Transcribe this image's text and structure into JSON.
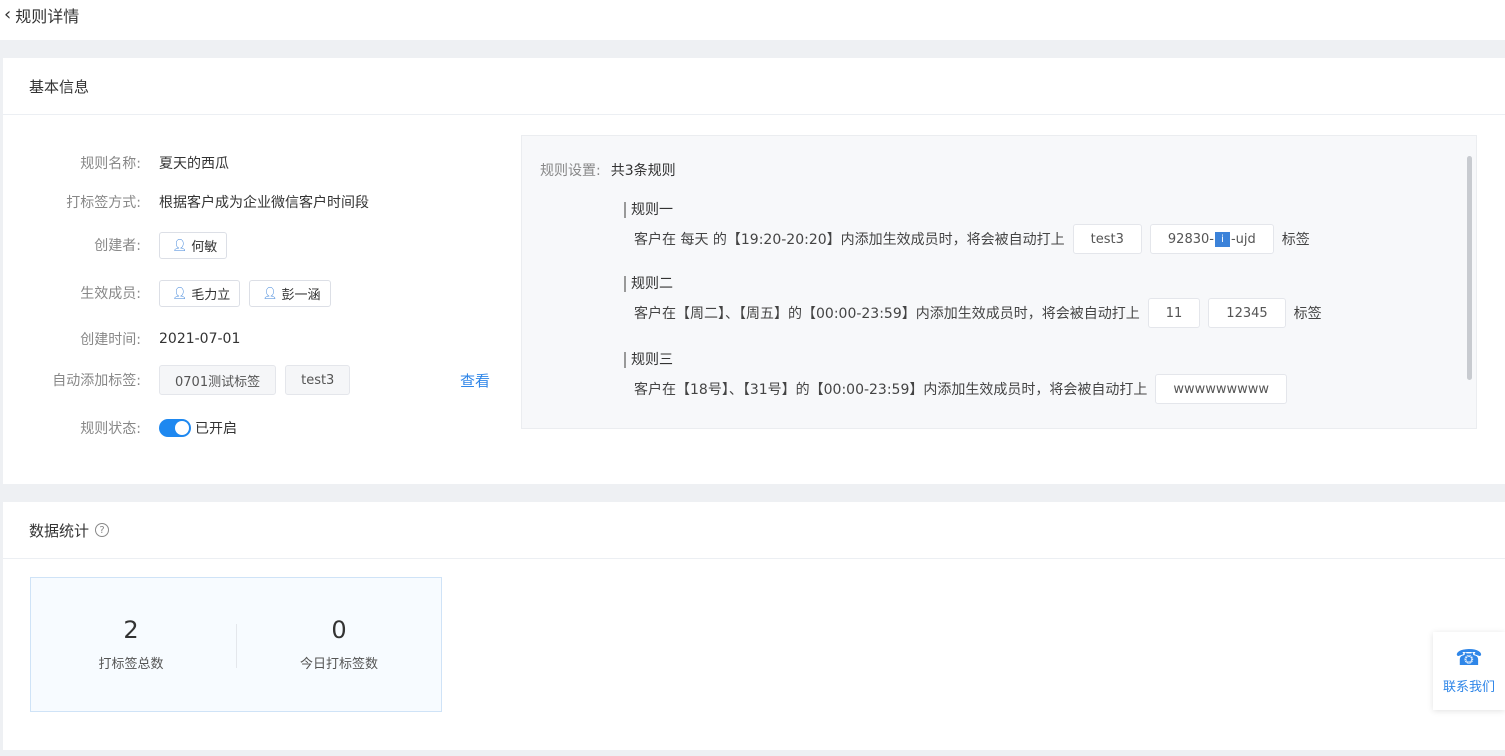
{
  "header": {
    "back_icon": "chevron-left-icon",
    "title": "规则详情"
  },
  "basic": {
    "section_title": "基本信息",
    "name_label": "规则名称:",
    "name_value": "夏天的西瓜",
    "method_label": "打标签方式:",
    "method_value": "根据客户成为企业微信客户时间段",
    "creator_label": "创建者:",
    "creator": "何敏",
    "members_label": "生效成员:",
    "members": [
      "毛力立",
      "彭一涵"
    ],
    "created_label": "创建时间:",
    "created_value": "2021-07-01",
    "tags_label": "自动添加标签:",
    "tags": [
      "0701测试标签",
      "test3"
    ],
    "view_link": "查看",
    "status_label": "规则状态:",
    "status_value": "已开启",
    "status_on": true
  },
  "rules": {
    "label": "规则设置:",
    "summary": "共3条规则",
    "items": [
      {
        "title": "规则一",
        "text": "客户在 每天 的【19:20-20:20】内添加生效成员时，将会被自动打上",
        "tags": [
          "test3",
          "92830-",
          "-ujd"
        ],
        "suffix": "标签"
      },
      {
        "title": "规则二",
        "text": "客户在【周二】、【周五】的【00:00-23:59】内添加生效成员时，将会被自动打上",
        "tags": [
          "11",
          "12345"
        ],
        "suffix": "标签"
      },
      {
        "title": "规则三",
        "text": "客户在【18号】、【31号】的【00:00-23:59】内添加生效成员时，将会被自动打上",
        "tags": [
          "wwwwwwwww"
        ]
      }
    ]
  },
  "stats": {
    "section_title": "数据统计",
    "total_value": "2",
    "total_label": "打标签总数",
    "today_value": "0",
    "today_label": "今日打标签数"
  },
  "contact": {
    "icon": "headset-icon",
    "label": "联系我们"
  },
  "colors": {
    "accent": "#1e88f0",
    "link": "#2f86e8"
  }
}
